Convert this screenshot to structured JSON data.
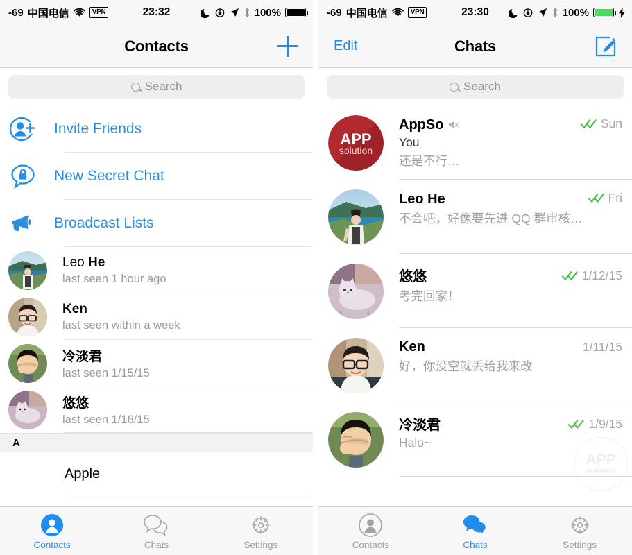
{
  "left": {
    "status": {
      "signal": "-69",
      "carrier": "中国电信",
      "wifi_icon": "wifi-icon",
      "vpn": "VPN",
      "time": "23:32",
      "moon_icon": "moon-icon",
      "rotation_lock_icon": "rotation-lock-icon",
      "location_icon": "location-arrow-icon",
      "bluetooth_icon": "bluetooth-icon",
      "battery_percent": "100%",
      "battery_state": "full"
    },
    "nav": {
      "title": "Contacts",
      "add_label": "add-contact"
    },
    "search": {
      "placeholder": "Search",
      "value": ""
    },
    "actions": [
      {
        "label": "Invite Friends",
        "icon": "person-add-icon"
      },
      {
        "label": "New Secret Chat",
        "icon": "lock-bubble-icon"
      },
      {
        "label": "Broadcast Lists",
        "icon": "megaphone-icon"
      }
    ],
    "contacts": [
      {
        "first": "Leo ",
        "last": "He",
        "status": "last seen 1 hour ago",
        "avatar": "leo-avatar"
      },
      {
        "first": "Ken",
        "last": "",
        "status": "last seen within a week",
        "avatar": "ken-avatar"
      },
      {
        "first": "冷淡君",
        "last": "",
        "status": "last seen 1/15/15",
        "avatar": "lengdanjun-avatar"
      },
      {
        "first": "悠悠",
        "last": "",
        "status": "last seen 1/16/15",
        "avatar": "youyou-avatar"
      }
    ],
    "section_header": "A",
    "section_rows": [
      {
        "name": "Apple"
      }
    ],
    "tabs": [
      {
        "label": "Contacts",
        "icon": "person-icon",
        "active": true
      },
      {
        "label": "Chats",
        "icon": "chat-bubbles-icon",
        "active": false
      },
      {
        "label": "Settings",
        "icon": "gear-icon",
        "active": false
      }
    ]
  },
  "right": {
    "status": {
      "signal": "-69",
      "carrier": "中国电信",
      "wifi_icon": "wifi-icon",
      "vpn": "VPN",
      "time": "23:30",
      "moon_icon": "moon-icon",
      "rotation_lock_icon": "rotation-lock-icon",
      "location_icon": "location-arrow-icon",
      "bluetooth_icon": "bluetooth-icon",
      "battery_percent": "100%",
      "battery_state": "charging"
    },
    "nav": {
      "edit_label": "Edit",
      "title": "Chats",
      "compose_label": "compose"
    },
    "search": {
      "placeholder": "Search",
      "value": ""
    },
    "chats": [
      {
        "name": "AppSo",
        "muted": true,
        "you_prefix": "You",
        "message": "还是不行…",
        "date": "Sun",
        "ticks": "double-check-read",
        "avatar": "appso-avatar"
      },
      {
        "name": "Leo He",
        "muted": false,
        "you_prefix": "",
        "message": "不会吧，好像要先进 QQ 群审核…",
        "date": "Fri",
        "ticks": "double-check-read",
        "avatar": "leo-avatar"
      },
      {
        "name": "悠悠",
        "muted": false,
        "you_prefix": "",
        "message": "考完回家！",
        "date": "1/12/15",
        "ticks": "double-check-read",
        "avatar": "youyou-avatar"
      },
      {
        "name": "Ken",
        "muted": false,
        "you_prefix": "",
        "message": "好，你没空就丢给我来改",
        "date": "1/11/15",
        "ticks": "none",
        "avatar": "ken-avatar"
      },
      {
        "name": "冷淡君",
        "muted": false,
        "you_prefix": "",
        "message": "Halo~",
        "date": "1/9/15",
        "ticks": "double-check-read",
        "avatar": "lengdanjun-avatar"
      }
    ],
    "watermark": {
      "line1": "APP",
      "line2": "solution"
    },
    "tabs": [
      {
        "label": "Contacts",
        "icon": "person-icon",
        "active": false
      },
      {
        "label": "Chats",
        "icon": "chat-bubbles-icon",
        "active": true
      },
      {
        "label": "Settings",
        "icon": "gear-icon",
        "active": false
      }
    ]
  },
  "colors": {
    "accent": "#1f8ded",
    "link": "#2a8fe0",
    "tick_green": "#44c044",
    "muted_text": "#a0a0a0",
    "chrome": "#f7f7f7",
    "search_bg": "#eeeeee",
    "appso_red": "#b02a2f"
  }
}
